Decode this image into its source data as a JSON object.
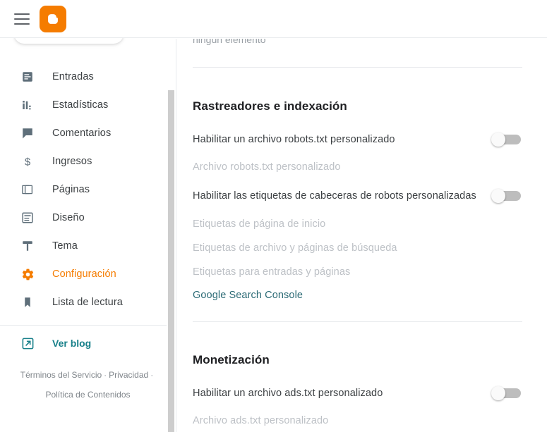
{
  "app": {
    "name": "Blogger",
    "logo_letter": "B"
  },
  "topbar": {
    "menu_icon": "hamburger-menu-icon",
    "logo_icon": "blogger-logo-icon"
  },
  "sidebar": {
    "items": [
      {
        "label": "Entradas",
        "icon": "posts-icon",
        "active": false
      },
      {
        "label": "Estadísticas",
        "icon": "stats-icon",
        "active": false
      },
      {
        "label": "Comentarios",
        "icon": "comments-icon",
        "active": false
      },
      {
        "label": "Ingresos",
        "icon": "earnings-icon",
        "active": false
      },
      {
        "label": "Páginas",
        "icon": "pages-icon",
        "active": false
      },
      {
        "label": "Diseño",
        "icon": "layout-icon",
        "active": false
      },
      {
        "label": "Tema",
        "icon": "theme-icon",
        "active": false
      },
      {
        "label": "Configuración",
        "icon": "gear-icon",
        "active": true
      },
      {
        "label": "Lista de lectura",
        "icon": "bookmark-icon",
        "active": false
      }
    ],
    "view_blog": {
      "label": "Ver blog",
      "icon": "external-link-icon"
    },
    "legal": {
      "terms": "Términos del Servicio",
      "separator1": "·",
      "privacy": "Privacidad",
      "separator2": "·",
      "content_policy": "Política de Contenidos"
    }
  },
  "main": {
    "clipped_top_text": "ningún elemento",
    "sections": [
      {
        "title": "Rastreadores e indexación",
        "rows": [
          {
            "type": "toggle",
            "label": "Habilitar un archivo robots.txt personalizado",
            "state": "off"
          },
          {
            "type": "subtext",
            "label": "Archivo robots.txt personalizado"
          },
          {
            "type": "toggle",
            "label": "Habilitar las etiquetas de cabeceras de robots personalizadas",
            "state": "off"
          },
          {
            "type": "subtext",
            "label": "Etiquetas de página de inicio"
          },
          {
            "type": "subtext",
            "label": "Etiquetas de archivo y páginas de búsqueda"
          },
          {
            "type": "subtext",
            "label": "Etiquetas para entradas y páginas"
          },
          {
            "type": "link",
            "label": "Google Search Console"
          }
        ]
      },
      {
        "title": "Monetización",
        "rows": [
          {
            "type": "toggle",
            "label": "Habilitar un archivo ads.txt personalizado",
            "state": "off"
          },
          {
            "type": "subtext",
            "label": "Archivo ads.txt personalizado"
          }
        ]
      }
    ]
  },
  "colors": {
    "accent_orange": "#f57c00",
    "link_teal": "#2c6b76",
    "view_blog_teal": "#18808a",
    "text_primary": "#3c4043",
    "text_muted": "#bdc1c6",
    "divider": "#e8eaed"
  },
  "scrollbar": {
    "orientation": "vertical",
    "position": "left-of-content"
  }
}
